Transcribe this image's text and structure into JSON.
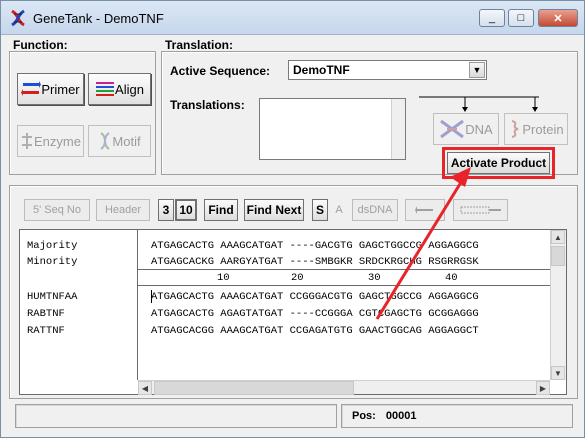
{
  "window": {
    "title": "GeneTank - DemoTNF",
    "minimize": "_",
    "maximize": "□",
    "close": "✕"
  },
  "function": {
    "label": "Function:",
    "buttons": [
      {
        "label": "Primer",
        "icon": "primer-icon",
        "enabled": true
      },
      {
        "label": "Align",
        "icon": "align-icon",
        "enabled": true
      },
      {
        "label": "Enzyme",
        "icon": "enzyme-icon",
        "enabled": false
      },
      {
        "label": "Motif",
        "icon": "motif-icon",
        "enabled": false
      }
    ]
  },
  "translation": {
    "label": "Translation:",
    "active_sequence_label": "Active Sequence:",
    "active_sequence_value": "DemoTNF",
    "translations_label": "Translations:",
    "dna_button": "DNA",
    "protein_button": "Protein",
    "activate_product_button": "Activate Product"
  },
  "toolbar": {
    "seq_no": "5' Seq No",
    "header": "Header",
    "n3": "3",
    "n10": "10",
    "find": "Find",
    "find_next": "Find Next",
    "s": "S",
    "a": "A",
    "dsdna": "dsDNA"
  },
  "sequences": {
    "consensus": [
      {
        "name": "Majority",
        "seq": "ATGAGCACTG AAAGCATGAT ----GACGTG GAGCTGGCCG AGGAGGCG"
      },
      {
        "name": "Minority",
        "seq": "ATGAGCACKG AARGYATGAT ----SMBGKR SRDCKRGCHG RSGRRGSK"
      }
    ],
    "ruler": [
      "10",
      "20",
      "30",
      "40"
    ],
    "rows": [
      {
        "name": "HUMTNFAA",
        "seq": "ATGAGCACTG AAAGCATGAT CCGGGACGTG GAGCTGGCCG AGGAGGCG"
      },
      {
        "name": "RABTNF",
        "seq": "ATGAGCACTG AGAGTATGAT ----CCGGGA CGTCGAGCTG GCGGAGGG"
      },
      {
        "name": "RATTNF",
        "seq": "ATGAGCACGG AAAGCATGAT CCGAGATGTG GAACTGGCAG AGGAGGCT"
      }
    ]
  },
  "status": {
    "left": "",
    "pos_label": "Pos:",
    "pos_value": "00001"
  },
  "colors": {
    "highlight": "#e8242a"
  }
}
